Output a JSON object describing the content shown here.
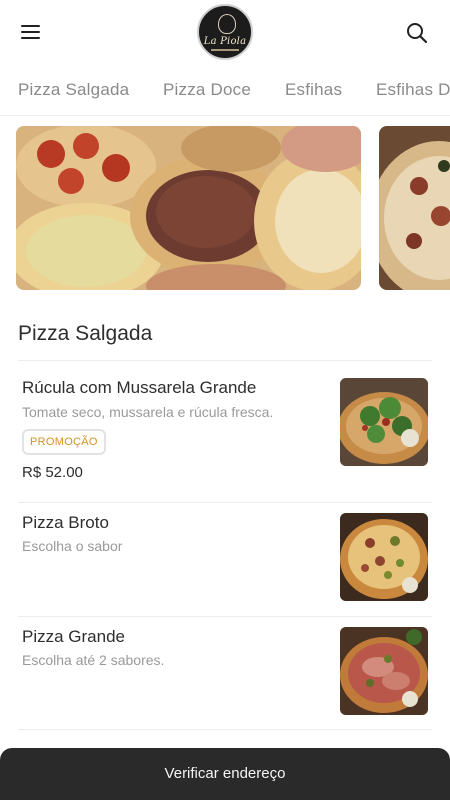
{
  "header": {
    "menu_icon": "hamburger-menu-icon",
    "logo_text": "La Piola",
    "search_icon": "search-icon"
  },
  "tabs": [
    {
      "label": "Pizza Salgada"
    },
    {
      "label": "Pizza Doce"
    },
    {
      "label": "Esfihas"
    },
    {
      "label": "Esfihas Doces"
    }
  ],
  "section": {
    "title": "Pizza Salgada"
  },
  "items": [
    {
      "name": "Rúcula com Mussarela Grande",
      "description": "Tomate seco, mussarela e rúcula fresca.",
      "badge": "PROMOÇÃO",
      "price": "R$ 52.00"
    },
    {
      "name": "Pizza Broto",
      "description": "Escolha o sabor"
    },
    {
      "name": "Pizza Grande",
      "description": "Escolha até 2 sabores."
    }
  ],
  "cta": {
    "label": "Verificar endereço"
  },
  "colors": {
    "badge_text": "#d4921f",
    "cta_background": "#2a2a2a",
    "tab_text": "#8a8a8a"
  }
}
